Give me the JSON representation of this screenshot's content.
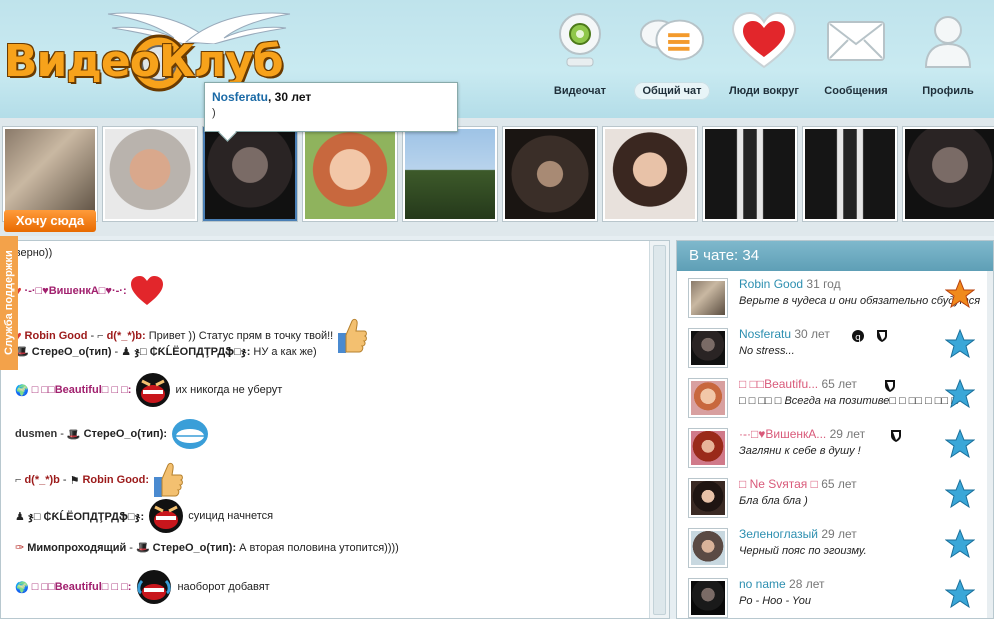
{
  "logo": {
    "text": "ВидеоКлуб"
  },
  "nav": {
    "items": [
      {
        "label": "Видеочат",
        "icon": "webcam-icon",
        "active": false
      },
      {
        "label": "Общий чат",
        "icon": "chat-bubbles-icon",
        "active": true
      },
      {
        "label": "Люди вокруг",
        "icon": "heart-icon",
        "active": false
      },
      {
        "label": "Сообщения",
        "icon": "envelope-icon",
        "active": false
      },
      {
        "label": "Профиль",
        "icon": "profile-icon",
        "active": false
      }
    ]
  },
  "tooltip": {
    "name": "Nosferatu",
    "age": ", 30 лет",
    "status": ")"
  },
  "strip": {
    "want_button": "Хочу сюда",
    "photo_count": 10,
    "selected_index": 2
  },
  "support": {
    "label": "Служба поддержки"
  },
  "chat": {
    "messages": [
      {
        "text": "(аверно))"
      },
      {
        "nick": "·-·□♥ВишенкА□♥·-·:",
        "icon": "heart-smiley-icon"
      },
      {
        "nick": "Robin Good",
        "to": "d(*_*)b:",
        "text": "Привет )) Статус прям в точку твой!!",
        "icon": "thumbs-up-icon"
      },
      {
        "nick": "СтереО_о(тип)",
        "to": "ჯ□ ₵ƘĹЁОПДŢРДֆ□ჯ:",
        "text": "НУ а как же)"
      },
      {
        "nick": "□ □□Beautiful□ □ □:",
        "text": "их никогда не уберут",
        "icon": "laughing-smiley-icon"
      },
      {
        "nick": "dusmen",
        "to": "СтереО_о(тип):",
        "icon": "grin-smiley-icon"
      },
      {
        "nick": "d(*_*)b",
        "to": "Robin Good:",
        "icon": "thumbs-up-icon"
      },
      {
        "nick": "ჯ□ ₵ƘĹЁОПДŢРДֆ□ჯ:",
        "text": "суицид начнется",
        "icon": "laughing-smiley-icon"
      },
      {
        "nick": "Мимопроходящий",
        "to": "СтереО_о(тип):",
        "text": "А вторая половина утопится))))"
      },
      {
        "nick": "□ □□Beautiful□ □ □:",
        "text": "наоборот добавят",
        "icon": "crying-smiley-icon"
      }
    ]
  },
  "side": {
    "title": "В чате: 34",
    "users": [
      {
        "name": "Robin Good",
        "age": "31 год",
        "status": "Верьте в чудеса и они обязательно сбудутся",
        "gender": "m",
        "badge": "gold-star-icon"
      },
      {
        "name": "Nosferatu",
        "age": "30 лет",
        "status": "No stress...",
        "gender": "m",
        "badge": "blue-star-icon",
        "extra": [
          "badge-icon",
          "shield-icon"
        ]
      },
      {
        "name": "□ □□Beautifu...",
        "age": "65 лет",
        "status": "□ □ □□ □ Всегда на позитиве□ □ □□ □ □□ □",
        "gender": "f",
        "badge": "blue-star-icon",
        "extra": [
          "shield-icon"
        ]
      },
      {
        "name": "·-·□♥ВишенкА...",
        "age": "29 лет",
        "status": "Загляни к себе в душу !",
        "gender": "f",
        "badge": "blue-star-icon",
        "extra": [
          "shield-icon"
        ]
      },
      {
        "name": "□ Ne Svятая □",
        "age": "65 лет",
        "status": "Бла бла бла )",
        "gender": "f",
        "badge": "blue-star-icon"
      },
      {
        "name": "Зеленоглазый",
        "age": "29 лет",
        "status": "Черный пояс по эгоизму.",
        "gender": "m",
        "badge": "blue-star-icon"
      },
      {
        "name": "no name",
        "age": "28 лет",
        "status": "Po - Hoo - You",
        "gender": "m",
        "badge": "blue-star-icon"
      }
    ]
  },
  "colors": {
    "accent": "#5e9fb6",
    "brand_orange": "#f7a21b",
    "want_button": "#e86a00"
  }
}
